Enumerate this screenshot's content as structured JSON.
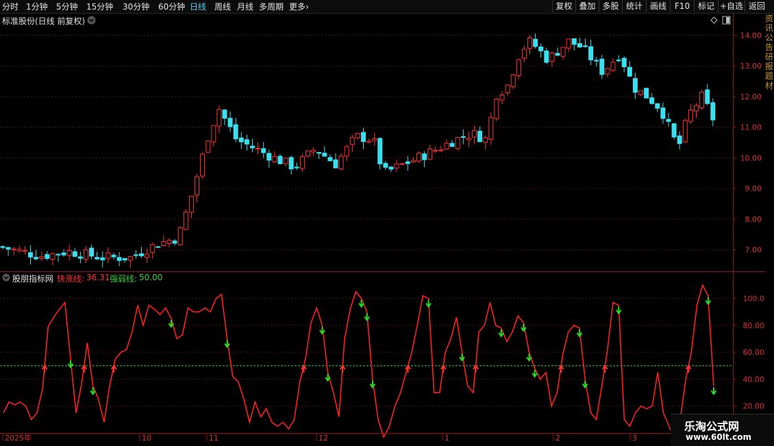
{
  "toolbar": {
    "periods": [
      "分时",
      "1分钟",
      "5分钟",
      "15分钟",
      "30分钟",
      "60分钟",
      "日线",
      "周线",
      "月线",
      "多周期",
      "更多"
    ],
    "active_period": "日线",
    "tools": [
      "复权",
      "叠加",
      "多股",
      "统计",
      "画线",
      "F10",
      "标记",
      "+自选",
      "返回"
    ]
  },
  "main_chart": {
    "title": "标准股份(日线 前复权)",
    "y_ticks": [
      "14.00",
      "13.00",
      "12.00",
      "11.00",
      "10.00",
      "9.00",
      "8.00",
      "7.00"
    ],
    "y_tick_values": [
      14,
      13,
      12,
      11,
      10,
      9,
      8,
      7
    ]
  },
  "indicator": {
    "name": "股朋指标网",
    "fast_label": "快涨线:",
    "fast_value": "36.31",
    "strong_label": "强弱线:",
    "strong_value": "50.00",
    "y_ticks": [
      "100.0",
      "80.00",
      "60.00",
      "40.00",
      "20.00"
    ],
    "y_tick_values": [
      100,
      80,
      60,
      40,
      20
    ],
    "threshold": 50
  },
  "x_axis": {
    "labels": [
      "2025年",
      "10",
      "11",
      "12",
      "1",
      "2",
      "3"
    ]
  },
  "side_strip_text": "资讯公告研报题材",
  "colors": {
    "up": "#ff3232",
    "down": "#3be0f0",
    "accent": "#4fd3f0",
    "bg": "#000000"
  },
  "watermark": {
    "line1": "乐淘公式网",
    "line2": "www.60lt.com"
  },
  "chart_data": {
    "type": "line",
    "description_series": "indicator line",
    "series": [
      {
        "name": "快涨线",
        "values": [
          15,
          23,
          21,
          23,
          20,
          10,
          15,
          33,
          79,
          86,
          92,
          97,
          55,
          15,
          37,
          67,
          35,
          25,
          8,
          35,
          55,
          60,
          62,
          75,
          95,
          80,
          95,
          92,
          88,
          93,
          85,
          70,
          73,
          93,
          90,
          90,
          93,
          90,
          100,
          103,
          70,
          42,
          38,
          25,
          8,
          23,
          12,
          18,
          8,
          5,
          8,
          3,
          10,
          38,
          55,
          82,
          93,
          80,
          45,
          30,
          12,
          70,
          92,
          105,
          100,
          90,
          40,
          10,
          -3,
          5,
          20,
          30,
          45,
          60,
          80,
          102,
          100,
          30,
          30,
          60,
          70,
          86,
          60,
          35,
          30,
          75,
          80,
          97,
          80,
          78,
          68,
          75,
          87,
          82,
          60,
          48,
          40,
          45,
          20,
          30,
          58,
          75,
          80,
          78,
          40,
          15,
          10,
          35,
          62,
          97,
          95,
          10,
          5,
          15,
          20,
          18,
          20,
          45,
          15,
          5,
          -5,
          10,
          40,
          60,
          95,
          110,
          102,
          35
        ],
        "line_color": "#ff2020"
      }
    ],
    "y_range": [
      0,
      110
    ],
    "threshold": 50,
    "price_range": [
      6.3,
      14.7
    ],
    "price_last_close": 11.1,
    "price_high": 14.6
  }
}
